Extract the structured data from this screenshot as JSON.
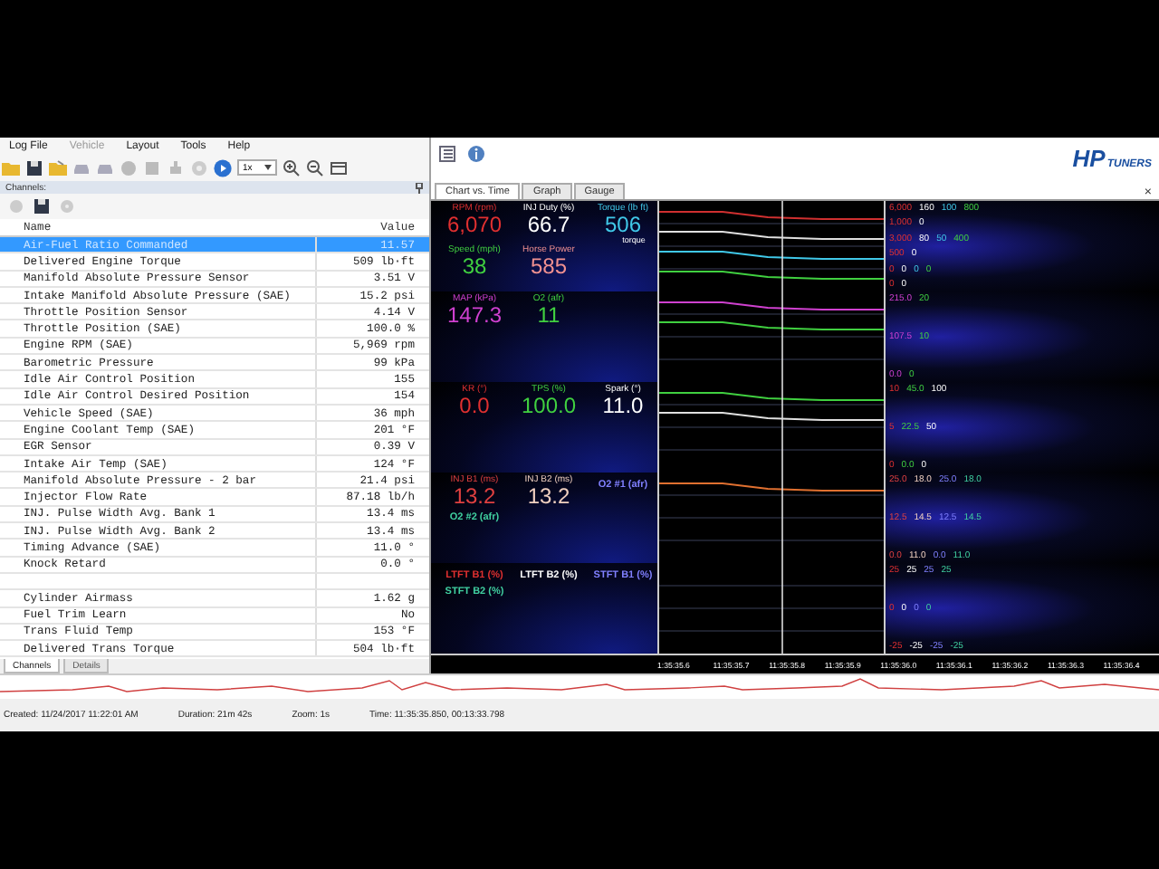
{
  "menu": [
    {
      "label": "Log File",
      "disabled": false
    },
    {
      "label": "Vehicle",
      "disabled": true
    },
    {
      "label": "Layout",
      "disabled": false
    },
    {
      "label": "Tools",
      "disabled": false
    },
    {
      "label": "Help",
      "disabled": false
    }
  ],
  "toolbar": {
    "speed": "1x"
  },
  "channels_pane": {
    "title": "Channels:",
    "columns": [
      "Name",
      "Value"
    ],
    "rows": [
      {
        "kind": "channel",
        "name": "Air-Fuel Ratio Commanded",
        "value": "11.57",
        "selected": true
      },
      {
        "kind": "channel",
        "name": "Delivered Engine Torque",
        "value": "509 lb·ft",
        "selected": false
      },
      {
        "kind": "channel",
        "name": "Manifold Absolute Pressure Sensor",
        "value": "3.51 V",
        "selected": false
      },
      {
        "kind": "channel",
        "name": "Intake Manifold Absolute Pressure (SAE)",
        "value": "15.2 psi",
        "selected": false
      },
      {
        "kind": "channel",
        "name": "Throttle Position Sensor",
        "value": "4.14 V",
        "selected": false
      },
      {
        "kind": "channel",
        "name": "Throttle Position (SAE)",
        "value": "100.0 %",
        "selected": false
      },
      {
        "kind": "channel",
        "name": "Engine RPM (SAE)",
        "value": "5,969 rpm",
        "selected": false
      },
      {
        "kind": "channel",
        "name": "Barometric Pressure",
        "value": "99 kPa",
        "selected": false
      },
      {
        "kind": "channel",
        "name": "Idle Air Control Position",
        "value": "155",
        "selected": false
      },
      {
        "kind": "channel",
        "name": "Idle Air Control Desired Position",
        "value": "154",
        "selected": false
      },
      {
        "kind": "channel",
        "name": "Vehicle Speed (SAE)",
        "value": "36 mph",
        "selected": false
      },
      {
        "kind": "channel",
        "name": "Engine Coolant Temp (SAE)",
        "value": "201 °F",
        "selected": false
      },
      {
        "kind": "channel",
        "name": "EGR Sensor",
        "value": "0.39 V",
        "selected": false
      },
      {
        "kind": "channel",
        "name": "Intake Air Temp (SAE)",
        "value": "124 °F",
        "selected": false
      },
      {
        "kind": "channel",
        "name": "Manifold Absolute Pressure - 2 bar",
        "value": "21.4 psi",
        "selected": false
      },
      {
        "kind": "channel",
        "name": "Injector Flow Rate",
        "value": "87.18 lb/h",
        "selected": false
      },
      {
        "kind": "channel",
        "name": "INJ. Pulse Width Avg. Bank 1",
        "value": "13.4 ms",
        "selected": false
      },
      {
        "kind": "channel",
        "name": "INJ. Pulse Width Avg. Bank 2",
        "value": "13.4 ms",
        "selected": false
      },
      {
        "kind": "channel",
        "name": "Timing Advance (SAE)",
        "value": "11.0 °",
        "selected": false
      },
      {
        "kind": "channel",
        "name": "Knock Retard",
        "value": "0.0 °",
        "selected": false
      },
      {
        "kind": "blank"
      },
      {
        "kind": "channel",
        "name": "Cylinder Airmass",
        "value": "1.62 g",
        "selected": false
      },
      {
        "kind": "channel",
        "name": "Fuel Trim Learn",
        "value": "No",
        "selected": false
      },
      {
        "kind": "channel",
        "name": "Trans Fluid Temp",
        "value": "153 °F",
        "selected": false
      },
      {
        "kind": "channel",
        "name": "Delivered Trans Torque",
        "value": "504 lb·ft",
        "selected": false
      }
    ]
  },
  "bottom_tabs": [
    {
      "label": "Channels",
      "selected": true
    },
    {
      "label": "Details",
      "selected": false
    }
  ],
  "logo": {
    "mark": "HP",
    "text": "TUNERS"
  },
  "tabs": [
    {
      "label": "Chart vs. Time",
      "selected": true
    },
    {
      "label": "Graph",
      "selected": false
    },
    {
      "label": "Gauge",
      "selected": false
    }
  ],
  "close": "×",
  "panels": [
    {
      "gauges": [
        {
          "label": "RPM (rpm)",
          "value": "6,070",
          "color": "#e03030"
        },
        {
          "label": "INJ Duty (%)",
          "value": "66.7",
          "color": "#ffffff"
        },
        {
          "label": "Torque (lb ft)",
          "value": "506",
          "note": "torque",
          "color": "#40c8e8"
        },
        {
          "label": "Speed (mph)",
          "value": "38",
          "color": "#40d040"
        },
        {
          "label": "Horse Power",
          "value": "585",
          "color": "#f09090"
        }
      ],
      "axis_rows": [
        [
          "6,000",
          "160",
          "100",
          "800"
        ],
        [
          "1,000",
          "0"
        ],
        [
          "3,000",
          "80",
          "50",
          "400"
        ],
        [
          "500",
          "0"
        ],
        [
          "0",
          "0",
          "0",
          "0"
        ],
        [
          "0",
          "0"
        ]
      ]
    },
    {
      "gauges": [
        {
          "label": "MAP (kPa)",
          "value": "147.3",
          "color": "#d040d0"
        },
        {
          "label": "O2 (afr)",
          "value": "11",
          "color": "#40d040"
        }
      ],
      "axis_rows": [
        [
          "215.0",
          "20"
        ],
        [
          "107.5",
          "10"
        ],
        [
          "0.0",
          "0"
        ]
      ]
    },
    {
      "gauges": [
        {
          "label": "KR (°)",
          "value": "0.0",
          "color": "#e03030"
        },
        {
          "label": "TPS (%)",
          "value": "100.0",
          "color": "#40d040"
        },
        {
          "label": "Spark (°)",
          "value": "11.0",
          "color": "#ffffff"
        }
      ],
      "axis_rows": [
        [
          "10",
          "45.0",
          "100"
        ],
        [
          "5",
          "22.5",
          "50"
        ],
        [
          "0",
          "0.0",
          "0"
        ]
      ]
    },
    {
      "gauges": [
        {
          "label": "INJ B1 (ms)",
          "value": "13.2",
          "color": "#e04040"
        },
        {
          "label": "INJ B2 (ms)",
          "value": "13.2",
          "color": "#f0d0c0"
        },
        {
          "label": "O2 #1 (afr)",
          "color": "#8080ff"
        },
        {
          "label": "O2 #2 (afr)",
          "color": "#40d0a0"
        }
      ],
      "axis_rows": [
        [
          "25.0",
          "18.0",
          "25.0",
          "18.0"
        ],
        [
          "12.5",
          "14.5",
          "12.5",
          "14.5"
        ],
        [
          "0.0",
          "11.0",
          "0.0",
          "11.0"
        ]
      ]
    },
    {
      "gauges": [
        {
          "label": "LTFT B1 (%)",
          "color": "#e03030"
        },
        {
          "label": "LTFT B2 (%)",
          "color": "#ffffff"
        },
        {
          "label": "STFT B1 (%)",
          "color": "#8080ff"
        },
        {
          "label": "STFT B2 (%)",
          "color": "#40d0a0"
        }
      ],
      "axis_rows": [
        [
          "25",
          "25",
          "25",
          "25"
        ],
        [
          "0",
          "0",
          "0",
          "0"
        ],
        [
          "-25",
          "-25",
          "-25",
          "-25"
        ]
      ]
    }
  ],
  "time_ticks": [
    "1:35:35.6",
    "11:35:35.7",
    "11:35:35.8",
    "11:35:35.9",
    "11:35:36.0",
    "11:35:36.1",
    "11:35:36.2",
    "11:35:36.3",
    "11:35:36.4"
  ],
  "status_bar": [
    "Created: 11/24/2017 11:22:01 AM",
    "Duration: 21m 42s",
    "Zoom: 1s",
    "Time: 11:35:35.850, 00:13:33.798"
  ]
}
